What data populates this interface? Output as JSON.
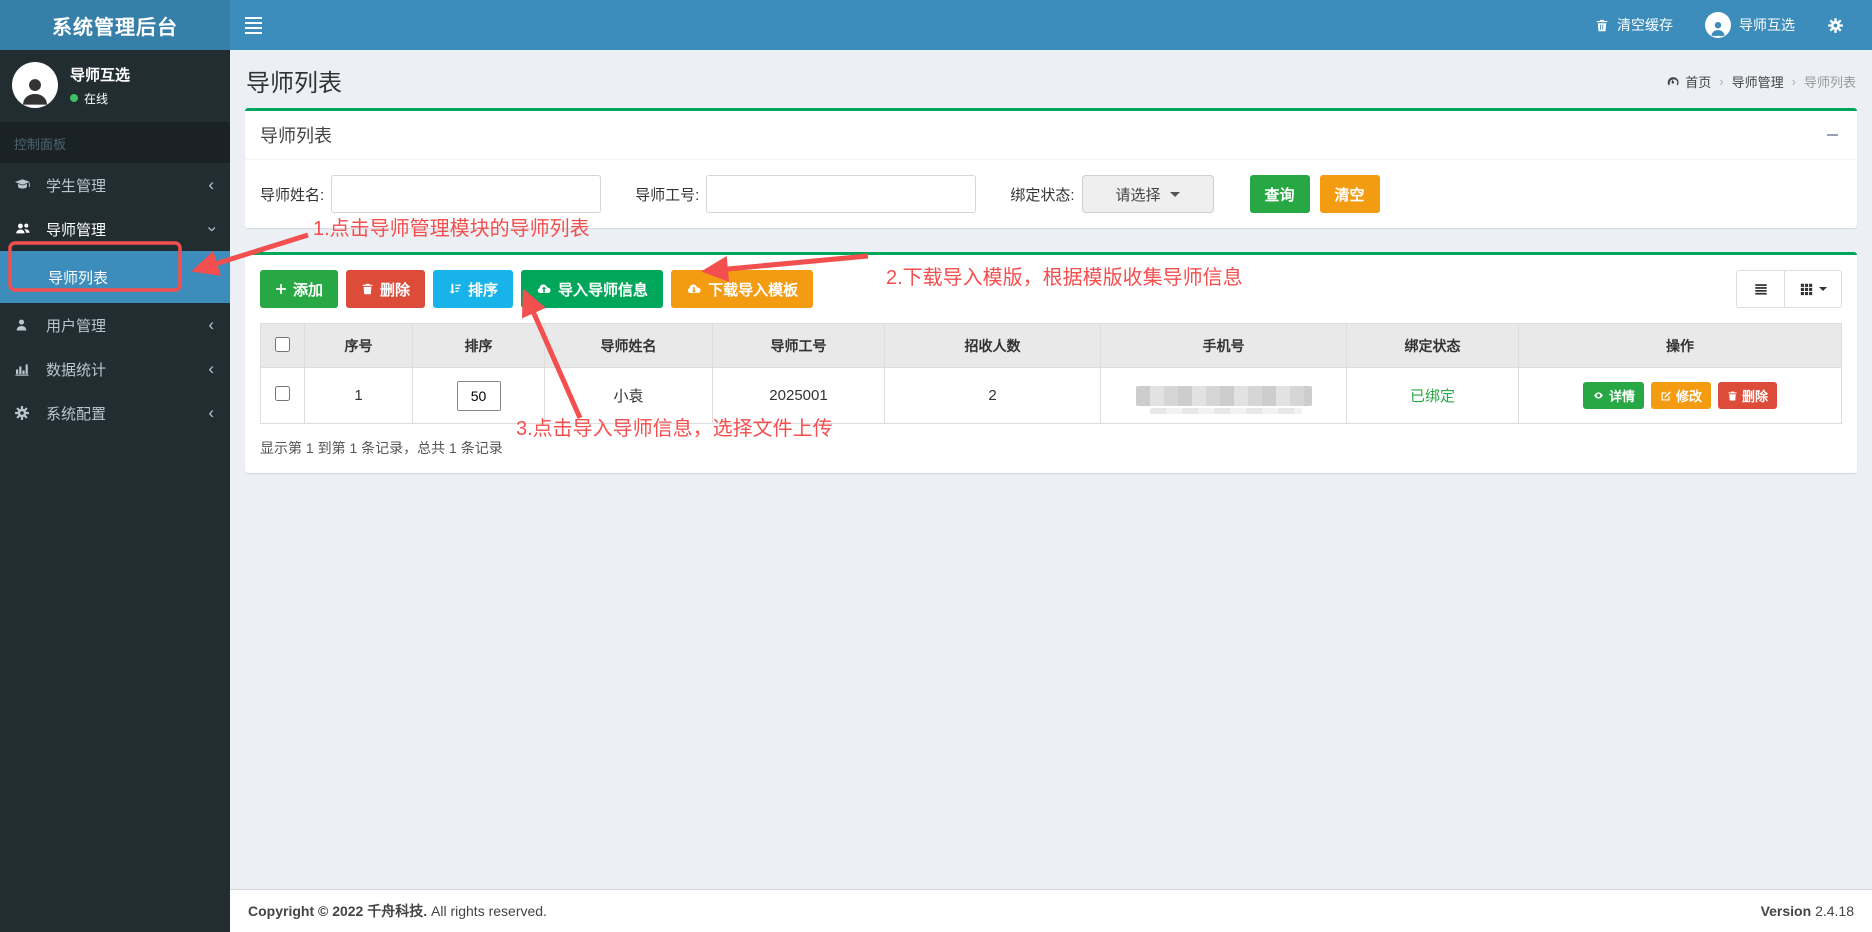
{
  "app": {
    "title": "系统管理后台"
  },
  "topbar": {
    "clear_cache": "清空缓存",
    "user_name": "导师互选",
    "icons": [
      "menu-icon",
      "trash-icon",
      "user-avatar-icon",
      "cogs-icon"
    ]
  },
  "sidebar": {
    "user": {
      "name": "导师互选",
      "status": "在线"
    },
    "section_label": "控制面板",
    "items": [
      {
        "label": "学生管理",
        "icon": "graduation-cap-icon",
        "state": "collapsed"
      },
      {
        "label": "导师管理",
        "icon": "users-icon",
        "state": "expanded",
        "children": [
          {
            "label": "导师列表",
            "active": true
          }
        ]
      },
      {
        "label": "用户管理",
        "icon": "user-icon",
        "state": "collapsed"
      },
      {
        "label": "数据统计",
        "icon": "bar-chart-icon",
        "state": "collapsed"
      },
      {
        "label": "系统配置",
        "icon": "cogs-icon",
        "state": "collapsed"
      }
    ]
  },
  "content": {
    "page_title": "导师列表",
    "breadcrumb": {
      "home": "首页",
      "section": "导师管理",
      "current": "导师列表"
    },
    "search_box": {
      "title": "导师列表",
      "name_label": "导师姓名:",
      "name_value": "",
      "no_label": "导师工号:",
      "no_value": "",
      "bind_label": "绑定状态:",
      "bind_selected": "请选择",
      "search_button": "查询",
      "clear_button": "清空"
    },
    "toolbar": {
      "add": "添加",
      "delete": "删除",
      "sort": "排序",
      "import": "导入导师信息",
      "download": "下载导入模板"
    },
    "table": {
      "headers": [
        "序号",
        "排序",
        "导师姓名",
        "导师工号",
        "招收人数",
        "手机号",
        "绑定状态",
        "操作"
      ],
      "rows": [
        {
          "index": "1",
          "sort": "50",
          "name": "小袁",
          "teacher_no": "2025001",
          "quota": "2",
          "phone_masked": true,
          "bind_status": "已绑定",
          "actions": {
            "detail": "详情",
            "edit": "修改",
            "delete": "删除"
          }
        }
      ],
      "pagination": "显示第 1 到第 1 条记录，总共 1 条记录"
    },
    "annotations": [
      "1.点击导师管理模块的导师列表",
      "2.下载导入模版，根据模版收集导师信息",
      "3.点击导入导师信息，选择文件上传"
    ]
  },
  "footer": {
    "copyright_bold": "Copyright © 2022 千舟科技.",
    "copyright_rest": "All rights reserved.",
    "version_label": "Version",
    "version_value": "2.4.18"
  },
  "colors": {
    "header_blue": "#3c8dbc",
    "sidebar_dark": "#222d32",
    "box_accent_green": "#00a65a",
    "btn_success": "#28a745",
    "btn_danger": "#dd4b39",
    "btn_info": "#17b3e9",
    "btn_warning": "#f39c12",
    "annotation_red": "#f34f4f",
    "bind_status_green": "#28a745"
  }
}
